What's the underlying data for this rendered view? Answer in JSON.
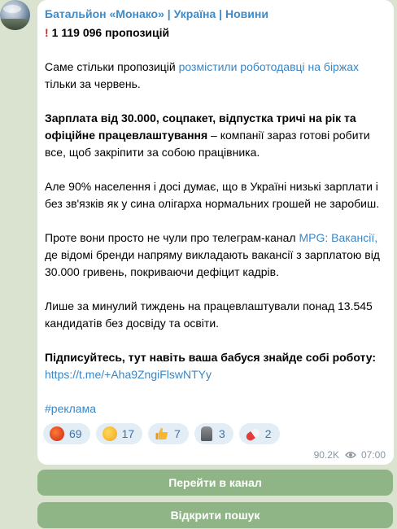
{
  "post": {
    "channel_title": "Батальйон «Монако» | Україна | Новини",
    "headline": "1 119 096 пропозицій",
    "p1_text": "Саме стільки пропозицій ",
    "p1_link": "розмістили роботодавці на біржах",
    "p1_tail": "тільки за червень.",
    "p2_bold": "Зарплата від 30.000, соцпакет, відпустка тричі на рік та офіційне працевлаштування",
    "p2_text": " – компанії зараз готові робити все, щоб закріпити за собою працівника.",
    "p3": "Але 90% населення і досі думає, що в Україні низькі зарплати і без зв'язків як у сина олігарха нормальних грошей не заробиш.",
    "p4_text": "Проте вони просто не чули про телеграм-канал ",
    "p4_link": "MPG: Вакансії,",
    "p4_tail": " де відомі бренди напряму викладають вакансії з зарплатою від 30.000 гривень, покриваючи дефіцит кадрів.",
    "p5": "Лише за минулий тиждень на працевлаштували понад 13.545 кандидатів без досвіду та освіти.",
    "p6_bold": "Підписуйтесь, тут навіть ваша бабуся знайде собі роботу:",
    "p6_link": "https://t.me/+Aha9ZngiFlswNTYy",
    "hashtag": "#реклама"
  },
  "reactions": [
    {
      "icon": "angry-face-icon",
      "count": "69"
    },
    {
      "icon": "smirk-face-icon",
      "count": "17"
    },
    {
      "icon": "thumbs-up-icon",
      "count": "7"
    },
    {
      "icon": "moai-icon",
      "count": "3"
    },
    {
      "icon": "pill-icon",
      "count": "2"
    }
  ],
  "meta": {
    "views": "90.2K",
    "time": "07:00"
  },
  "buttons": {
    "go_to_channel": "Перейти в канал",
    "open_search": "Відкрити пошук"
  },
  "colors": {
    "link": "#3a86c5",
    "title": "#3d8bc9",
    "button_bg": "#8fb587",
    "reaction_bg": "#e3edf6",
    "chat_bg": "#d9e3cf"
  }
}
